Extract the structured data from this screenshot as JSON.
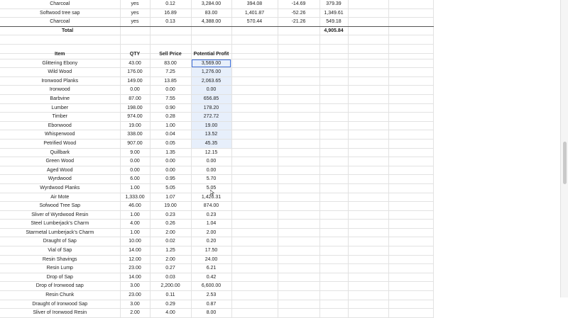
{
  "top_table": {
    "rows": [
      {
        "item": "Charcoal",
        "flag": "yes",
        "a": "0.12",
        "b": "3,284.00",
        "c": "394.08",
        "d": "-14.69",
        "e": "379.39"
      },
      {
        "item": "Softwood tree sap",
        "flag": "yes",
        "a": "16.89",
        "b": "83.00",
        "c": "1,401.87",
        "d": "-52.26",
        "e": "1,349.61"
      },
      {
        "item": "Charcoal",
        "flag": "yes",
        "a": "0.13",
        "b": "4,388.00",
        "c": "570.44",
        "d": "-21.26",
        "e": "549.18"
      }
    ],
    "total_label": "Total",
    "total_value": "4,905.84"
  },
  "profit_table": {
    "headers": {
      "item": "Item",
      "qty": "QTY",
      "price": "Sell Price",
      "profit": "Potential Profit"
    },
    "rows": [
      {
        "item": "Glittering Ebony",
        "qty": "43.00",
        "price": "83.00",
        "profit": "3,569.00"
      },
      {
        "item": "Wild Wood",
        "qty": "176.00",
        "price": "7.25",
        "profit": "1,276.00"
      },
      {
        "item": "Ironwood Planks",
        "qty": "149.00",
        "price": "13.85",
        "profit": "2,063.65"
      },
      {
        "item": "Ironwood",
        "qty": "0.00",
        "price": "0.00",
        "profit": "0.00"
      },
      {
        "item": "Barbvine",
        "qty": "87.00",
        "price": "7.55",
        "profit": "656.85"
      },
      {
        "item": "Lumber",
        "qty": "198.00",
        "price": "0.90",
        "profit": "178.20"
      },
      {
        "item": "Timber",
        "qty": "974.00",
        "price": "0.28",
        "profit": "272.72"
      },
      {
        "item": "Ebonwood",
        "qty": "19.00",
        "price": "1.00",
        "profit": "19.00"
      },
      {
        "item": "Whisperwood",
        "qty": "338.00",
        "price": "0.04",
        "profit": "13.52"
      },
      {
        "item": "Petrified Wood",
        "qty": "907.00",
        "price": "0.05",
        "profit": "45.35"
      },
      {
        "item": "Quillbark",
        "qty": "9.00",
        "price": "1.35",
        "profit": "12.15"
      },
      {
        "item": "Green Wood",
        "qty": "0.00",
        "price": "0.00",
        "profit": "0.00"
      },
      {
        "item": "Aged Wood",
        "qty": "0.00",
        "price": "0.00",
        "profit": "0.00"
      },
      {
        "item": "Wyrdwood",
        "qty": "6.00",
        "price": "0.95",
        "profit": "5.70"
      },
      {
        "item": "Wyrdwood Planks",
        "qty": "1.00",
        "price": "5.05",
        "profit": "5.05"
      },
      {
        "item": "Air Mote",
        "qty": "1,333.00",
        "price": "1.07",
        "profit": "1,426.31"
      },
      {
        "item": "Sofwood Tree Sap",
        "qty": "46.00",
        "price": "19.00",
        "profit": "874.00"
      },
      {
        "item": "Sliver of Wyrdwood Resin",
        "qty": "1.00",
        "price": "0.23",
        "profit": "0.23"
      },
      {
        "item": "Steel Lumberjack's Charm",
        "qty": "4.00",
        "price": "0.26",
        "profit": "1.04"
      },
      {
        "item": "Starmetal Lumberjack's Charm",
        "qty": "1.00",
        "price": "2.00",
        "profit": "2.00"
      },
      {
        "item": "Draught of Sap",
        "qty": "10.00",
        "price": "0.02",
        "profit": "0.20"
      },
      {
        "item": "Vial of Sap",
        "qty": "14.00",
        "price": "1.25",
        "profit": "17.50"
      },
      {
        "item": "Resin Shavings",
        "qty": "12.00",
        "price": "2.00",
        "profit": "24.00"
      },
      {
        "item": "Resin Lump",
        "qty": "23.00",
        "price": "0.27",
        "profit": "6.21"
      },
      {
        "item": "Drop of Sap",
        "qty": "14.00",
        "price": "0.03",
        "profit": "0.42"
      },
      {
        "item": "Drop of Ironwood sap",
        "qty": "3.00",
        "price": "2,200.00",
        "profit": "6,600.00"
      },
      {
        "item": "Resin Chunk",
        "qty": "23.00",
        "price": "0.11",
        "profit": "2.53"
      },
      {
        "item": "Draught of Ironwood Sap",
        "qty": "3.00",
        "price": "0.29",
        "profit": "0.87"
      },
      {
        "item": "Sliver of Ironwood Resin",
        "qty": "2.00",
        "price": "4.00",
        "profit": "8.00"
      }
    ]
  },
  "selection": {
    "highlight_color": "#e7effb",
    "active_border_color": "#3f6fd8"
  }
}
